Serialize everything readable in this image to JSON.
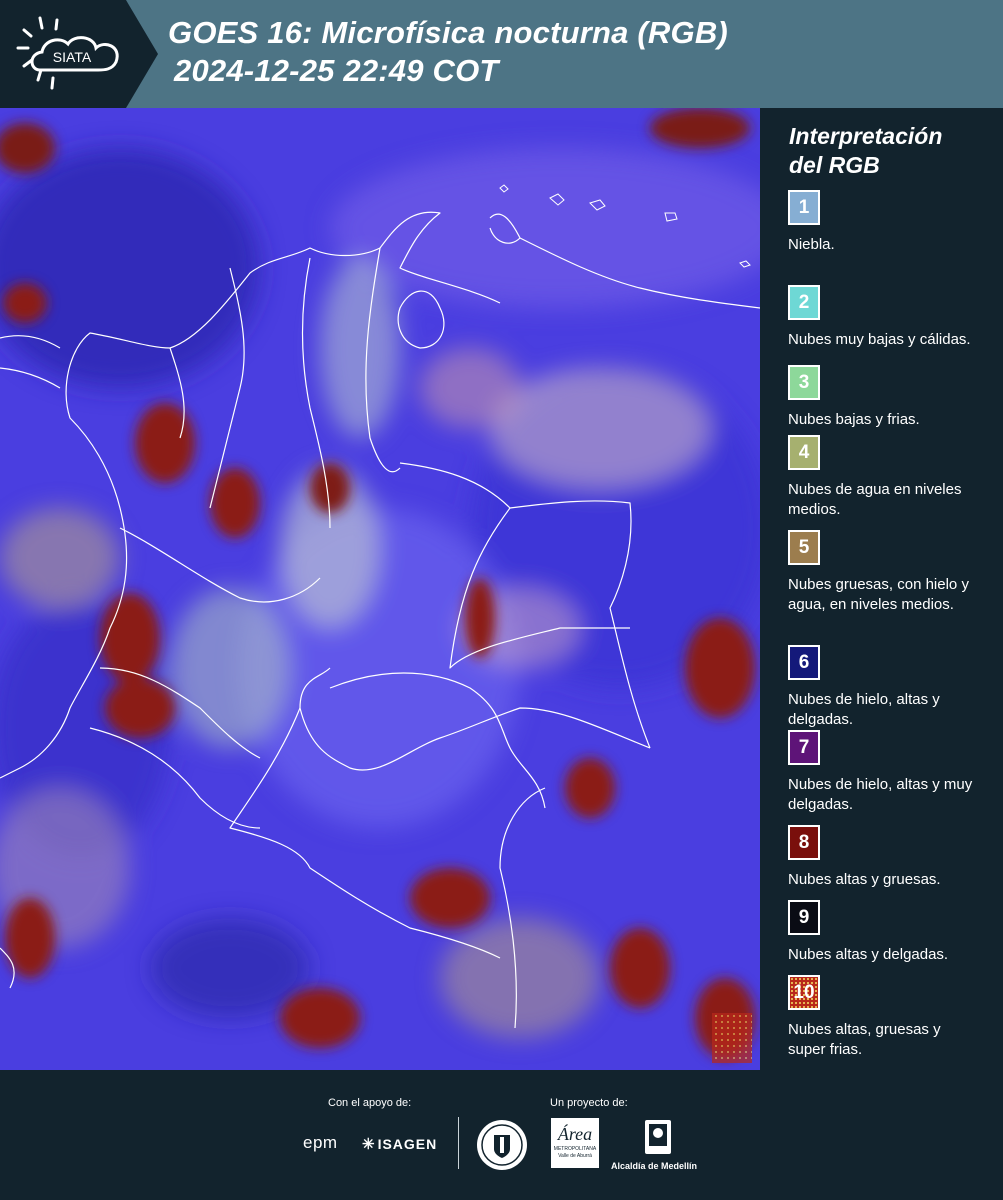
{
  "header": {
    "logo_text": "SIATA",
    "title_line1": "GOES 16: Microfísica nocturna (RGB)",
    "title_line2": "2024-12-25 22:49 COT"
  },
  "legend": {
    "title_line1": "Interpretación",
    "title_line2": "del RGB",
    "items": [
      {
        "number": "1",
        "label": "Niebla.",
        "color": "#86aed3"
      },
      {
        "number": "2",
        "label": "Nubes muy bajas y cálidas.",
        "color": "#6ed8d5"
      },
      {
        "number": "3",
        "label": "Nubes bajas y frias.",
        "color": "#8dd89a"
      },
      {
        "number": "4",
        "label": "Nubes de agua en niveles medios.",
        "color": "#a6b06f"
      },
      {
        "number": "5",
        "label": "Nubes gruesas, con hielo y agua, en niveles medios.",
        "color": "#9c7d4e"
      },
      {
        "number": "6",
        "label": "Nubes de hielo, altas y delgadas.",
        "color": "#14197a"
      },
      {
        "number": "7",
        "label": "Nubes de hielo, altas y muy delgadas.",
        "color": "#5e1478"
      },
      {
        "number": "8",
        "label": "Nubes altas y gruesas.",
        "color": "#7a0f0c"
      },
      {
        "number": "9",
        "label": "Nubes altas y delgadas.",
        "color": "#0a0c14"
      },
      {
        "number": "10",
        "label": "Nubes altas, gruesas y super frias.",
        "color": "#b8281a"
      }
    ]
  },
  "footer": {
    "support_label": "Con el apoyo de:",
    "project_label": "Un proyecto de:",
    "sponsor1": "epm",
    "sponsor2": "ISAGEN",
    "partner_amva": "Área",
    "partner_amva_sub1": "METROPOLITANA",
    "partner_amva_sub2": "Valle de Aburrá",
    "partner_medellin": "Alcaldía de Medellín"
  }
}
